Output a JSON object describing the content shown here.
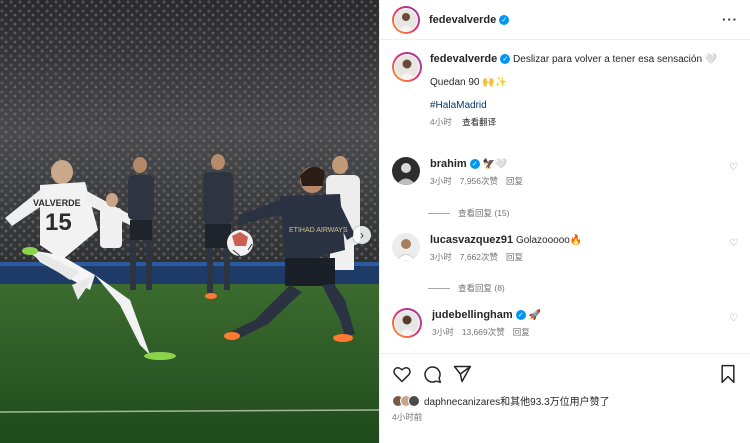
{
  "header": {
    "username": "fedevalverde",
    "more_icon": "more-horizontal-icon"
  },
  "caption": {
    "username": "fedevalverde",
    "text": "Deslizar para volver a tener esa sensación 🤍",
    "line2": "Quedan 90 🙌✨",
    "hashtag": "#HalaMadrid",
    "time": "4小时",
    "translate": "查看翻译"
  },
  "comments": [
    {
      "username": "brahim",
      "text": "🦅🤍",
      "time": "3小时",
      "likes": "7,956次赞",
      "reply": "回复",
      "view_replies": "查看回复 (15)"
    },
    {
      "username": "lucasvazquez91",
      "text": "Golazooooo🔥",
      "time": "3小时",
      "likes": "7,662次赞",
      "reply": "回复",
      "view_replies": "查看回复 (8)"
    },
    {
      "username": "judebellingham",
      "text": "🚀",
      "time": "3小时",
      "likes": "13,669次赞",
      "reply": "回复"
    }
  ],
  "likes": {
    "text": "daphnecanizares和其他93.3万位用户赞了"
  },
  "post_time": "4小时前",
  "photo": {
    "player_name": "VALVERDE",
    "player_number": "15",
    "sponsor_text": "ETIHAD AIRWAYS"
  },
  "colors": {
    "verified": "#0095f6",
    "hashtag": "#00376b",
    "muted": "#737373",
    "text": "#262626"
  }
}
